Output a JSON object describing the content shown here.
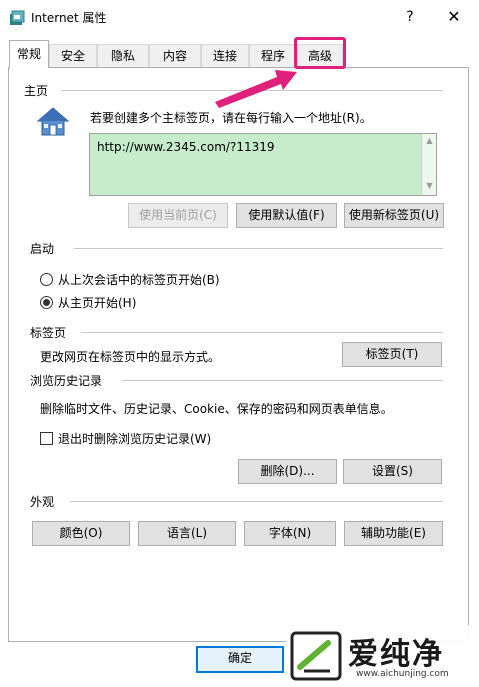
{
  "window": {
    "title": "Internet 属性",
    "help_label": "?",
    "close_label": "✕"
  },
  "tabs": [
    {
      "label": "常规",
      "active": true
    },
    {
      "label": "安全"
    },
    {
      "label": "隐私"
    },
    {
      "label": "内容"
    },
    {
      "label": "连接"
    },
    {
      "label": "程序"
    },
    {
      "label": "高级",
      "highlighted": true
    }
  ],
  "home": {
    "title": "主页",
    "description": "若要创建多个主标签页，请在每行输入一个地址(R)。",
    "url": "http://www.2345.com/?11319",
    "use_current_label": "使用当前页(C)",
    "use_default_label": "使用默认值(F)",
    "use_new_tab_label": "使用新标签页(U)"
  },
  "startup": {
    "title": "启动",
    "option_last_session": "从上次会话中的标签页开始(B)",
    "option_home": "从主页开始(H)",
    "selected": "home"
  },
  "tabs_section": {
    "title": "标签页",
    "description": "更改网页在标签页中的显示方式。",
    "button_label": "标签页(T)"
  },
  "history": {
    "title": "浏览历史记录",
    "description": "删除临时文件、历史记录、Cookie、保存的密码和网页表单信息。",
    "delete_on_exit_label": "退出时删除浏览历史记录(W)",
    "delete_on_exit_checked": false,
    "delete_label": "删除(D)...",
    "settings_label": "设置(S)"
  },
  "appearance": {
    "title": "外观",
    "colors_label": "颜色(O)",
    "languages_label": "语言(L)",
    "fonts_label": "字体(N)",
    "accessibility_label": "辅助功能(E)"
  },
  "footer": {
    "ok_label": "确定"
  },
  "watermark": {
    "brand": "爱纯净",
    "site": "www.aichunjing.com"
  },
  "colors": {
    "highlight": "#e0207a",
    "url_box": "#c7eccb",
    "accent": "#0078d7"
  }
}
